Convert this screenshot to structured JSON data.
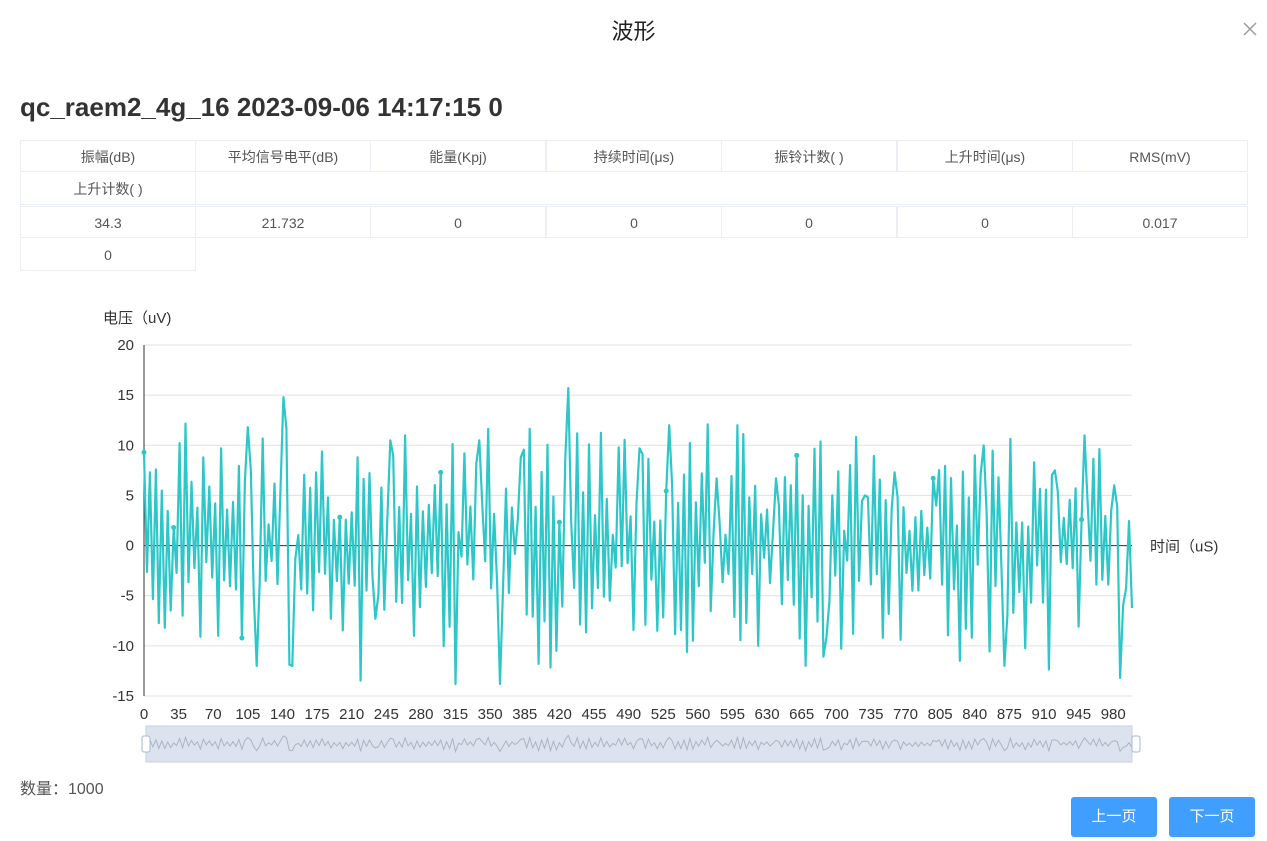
{
  "dialog": {
    "title": "波形"
  },
  "record": {
    "title": "qc_raem2_4g_16 2023-09-06 14:17:15 0"
  },
  "stats": {
    "headers": [
      "振幅(dB)",
      "平均信号电平(dB)",
      "能量(Kpj)",
      "持续时间(μs)",
      "振铃计数( )",
      "上升时间(μs)",
      "RMS(mV)",
      "上升计数( )"
    ],
    "values": [
      "34.3",
      "21.732",
      "0",
      "0",
      "0",
      "0",
      "0.017",
      "0"
    ]
  },
  "chart_data": {
    "type": "line",
    "ylabel": "电压（uV)",
    "xlabel": "时间（uS)",
    "y_ticks": [
      "20",
      "15",
      "10",
      "5",
      "0",
      "-5",
      "-10",
      "-15"
    ],
    "x_ticks": [
      "0",
      "35",
      "70",
      "105",
      "140",
      "175",
      "210",
      "245",
      "280",
      "315",
      "350",
      "385",
      "420",
      "455",
      "490",
      "525",
      "560",
      "595",
      "630",
      "665",
      "700",
      "735",
      "770",
      "805",
      "840",
      "875",
      "910",
      "945",
      "980"
    ],
    "ylim": [
      -15,
      20
    ],
    "xlim": [
      0,
      999
    ],
    "grid": true,
    "line_color": "#2ec7c9",
    "series": [
      {
        "peaks": [
          [
            0,
            9.3
          ],
          [
            20,
            -8.2
          ],
          [
            30,
            1.8
          ],
          [
            60,
            8.8
          ],
          [
            75,
            -9
          ],
          [
            105,
            11.8
          ],
          [
            115,
            -12
          ],
          [
            140,
            14.8
          ],
          [
            150,
            -12
          ],
          [
            175,
            7.3
          ],
          [
            190,
            -7.3
          ],
          [
            215,
            8.8
          ],
          [
            235,
            -7.3
          ],
          [
            250,
            10.5
          ],
          [
            272,
            -9
          ],
          [
            300,
            7.3
          ],
          [
            315,
            -13.8
          ],
          [
            340,
            10.5
          ],
          [
            360,
            -13.8
          ],
          [
            380,
            8.8
          ],
          [
            400,
            -11.8
          ],
          [
            418,
            -10.5
          ],
          [
            430,
            15.7
          ],
          [
            450,
            10.1
          ],
          [
            470,
            -5.5
          ],
          [
            500,
            9.7
          ],
          [
            520,
            -8.5
          ],
          [
            530,
            12
          ],
          [
            555,
            -9.5
          ],
          [
            565,
            7.2
          ],
          [
            580,
            6.7
          ],
          [
            600,
            12
          ],
          [
            620,
            -10
          ],
          [
            640,
            6.7
          ],
          [
            660,
            9
          ],
          [
            670,
            -12
          ],
          [
            690,
            -9.2
          ],
          [
            700,
            -3
          ],
          [
            730,
            5
          ],
          [
            760,
            7.3
          ],
          [
            800,
            4
          ],
          [
            830,
            -8.3
          ],
          [
            850,
            10
          ],
          [
            870,
            -12
          ],
          [
            900,
            8.3
          ],
          [
            920,
            7.5
          ],
          [
            950,
            11
          ],
          [
            980,
            6
          ],
          [
            990,
            -6
          ]
        ],
        "note": ""
      }
    ],
    "values_sample": [
      9.3,
      -8.2,
      4.5,
      -2.6,
      1.8,
      -6.5,
      8.8,
      -9.0,
      6.9,
      -3.3,
      11.8,
      -12.0,
      14.8,
      -12.0,
      7.3,
      -7.3,
      8.8,
      -7.3,
      10.5,
      -9.0,
      7.3,
      -13.8,
      10.5,
      -13.8,
      15.7,
      -11.8,
      10.1,
      -10.5,
      12.0,
      -9.5,
      7.2,
      -5.5,
      12.0,
      -10.0,
      9.7,
      -11.0,
      5.0,
      -8.5,
      10.0,
      -12.0,
      13.0,
      -9.0,
      8.3,
      -10.0,
      11.0,
      -8.3,
      14.8,
      -13.8,
      3.7
    ]
  },
  "footer": {
    "count_label": "数量：1000"
  },
  "buttons": {
    "prev": "上一页",
    "next": "下一页"
  }
}
